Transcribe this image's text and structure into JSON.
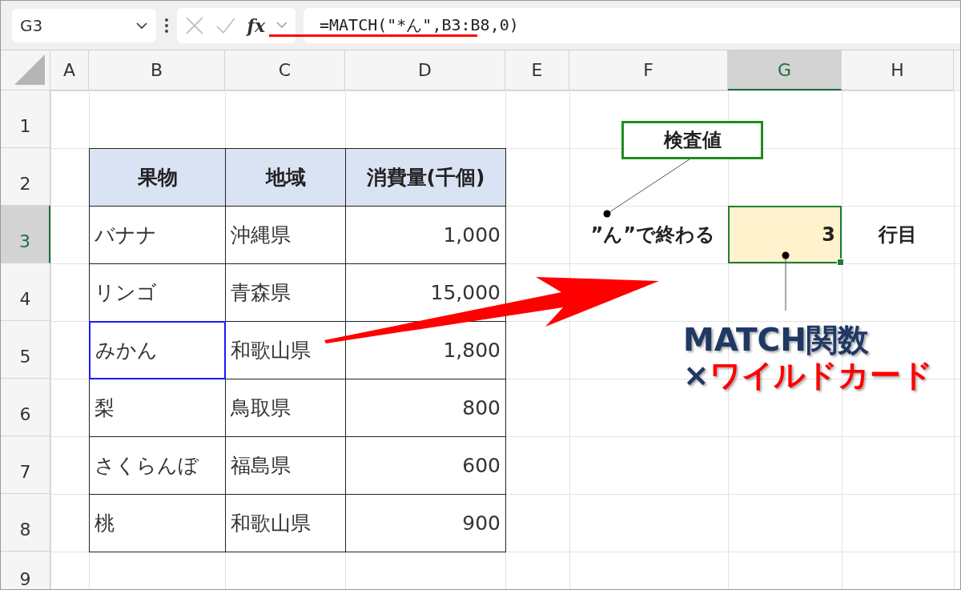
{
  "name_box": {
    "value": "G3"
  },
  "formula_bar": {
    "function_label": "fx",
    "formula": "=MATCH(\"*ん\",B3:B8,0)"
  },
  "columns": [
    {
      "label": "A",
      "selected": false
    },
    {
      "label": "B",
      "selected": false
    },
    {
      "label": "C",
      "selected": false
    },
    {
      "label": "D",
      "selected": false
    },
    {
      "label": "E",
      "selected": false
    },
    {
      "label": "F",
      "selected": false
    },
    {
      "label": "G",
      "selected": true
    },
    {
      "label": "H",
      "selected": false
    }
  ],
  "rows": [
    {
      "label": "1",
      "selected": false
    },
    {
      "label": "2",
      "selected": false
    },
    {
      "label": "3",
      "selected": true
    },
    {
      "label": "4",
      "selected": false
    },
    {
      "label": "5",
      "selected": false
    },
    {
      "label": "6",
      "selected": false
    },
    {
      "label": "7",
      "selected": false
    },
    {
      "label": "8",
      "selected": false
    },
    {
      "label": "9",
      "selected": false
    }
  ],
  "table": {
    "headers": [
      "果物",
      "地域",
      "消費量(千個)"
    ],
    "rows": [
      {
        "fruit": "バナナ",
        "region": "沖縄県",
        "amount": "1,000",
        "highlighted": false
      },
      {
        "fruit": "リンゴ",
        "region": "青森県",
        "amount": "15,000",
        "highlighted": false
      },
      {
        "fruit": "みかん",
        "region": "和歌山県",
        "amount": "1,800",
        "highlighted": true
      },
      {
        "fruit": "梨",
        "region": "鳥取県",
        "amount": "800",
        "highlighted": false
      },
      {
        "fruit": "さくらんぼ",
        "region": "福島県",
        "amount": "600",
        "highlighted": false
      },
      {
        "fruit": "桃",
        "region": "和歌山県",
        "amount": "900",
        "highlighted": false
      }
    ]
  },
  "lookup": {
    "label": "”ん”で終わる",
    "result": "3",
    "suffix": "行目",
    "selected": true
  },
  "callout": "検査値",
  "headline": {
    "line1": "MATCH関数",
    "line2_prefix": "×",
    "line2_emphasis": "ワイルドカード"
  }
}
